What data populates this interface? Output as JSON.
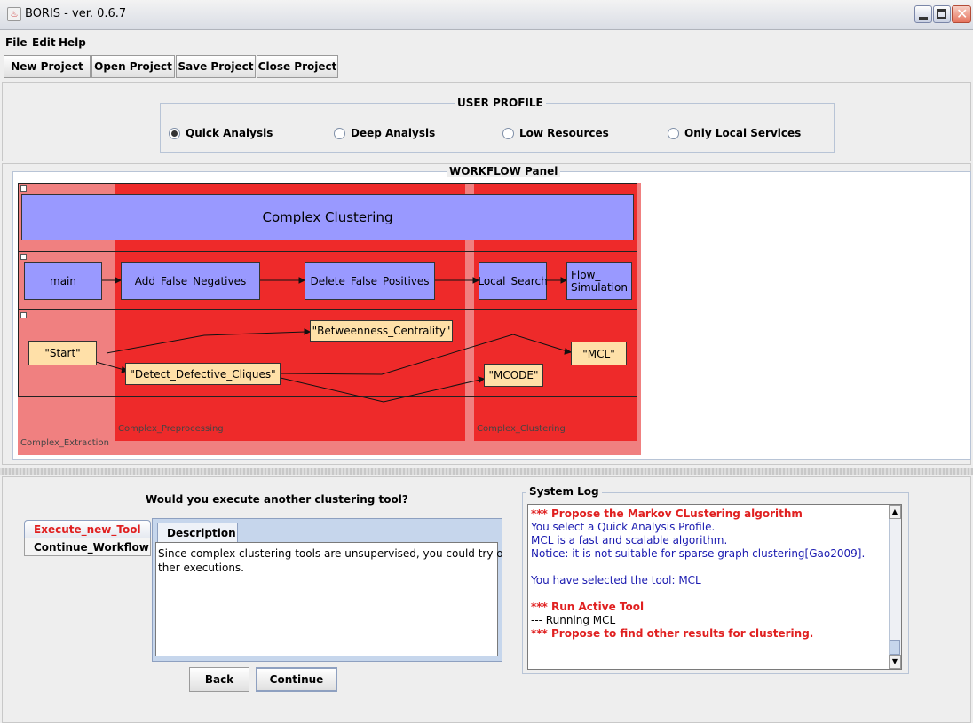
{
  "window": {
    "title": "BORIS - ver. 0.6.7"
  },
  "menu": [
    "File",
    "Edit",
    "Help"
  ],
  "toolbar": {
    "new": "New Project",
    "open": "Open Project",
    "save": "Save Project",
    "close": "Close Project"
  },
  "profile": {
    "title": "USER PROFILE",
    "options": [
      "Quick Analysis",
      "Deep Analysis",
      "Low Resources",
      "Only Local Services"
    ],
    "selected": "Quick Analysis"
  },
  "workflow": {
    "title": "WORKFLOW Panel",
    "top_node": "Complex Clustering",
    "nodes": [
      "main",
      "Add_False_Negatives",
      "Delete_False_Positives",
      "Local_Search",
      "Flow_\nSimulation"
    ],
    "tasks": [
      "\"Start\"",
      "\"Betweenness_Centrality\"",
      "\"Detect_Defective_Cliques\"",
      "\"MCL\"",
      "\"MCODE\""
    ],
    "lanes": [
      "Complex_Extraction",
      "Complex_Preprocessing",
      "Complex_Clustering"
    ]
  },
  "dialog": {
    "question": "Would you execute another clustering tool?",
    "tabs": [
      "Execute_new_Tool",
      "Continue_Workflow"
    ],
    "active_tab": "Execute_new_Tool",
    "desc_tab": "Description",
    "desc_text": "Since complex clustering tools are unsupervised, you could try o\nther executions.",
    "back": "Back",
    "continue": "Continue"
  },
  "log": {
    "title": "System Log",
    "lines": [
      {
        "text": "*** Propose the Markov CLustering algorithm",
        "style": "red-bold"
      },
      {
        "text": "You select a Quick Analysis Profile.",
        "style": "blue"
      },
      {
        "text": "MCL is a fast and scalable algorithm.",
        "style": "blue"
      },
      {
        "text": "Notice: it is not suitable for sparse graph clustering[Gao2009].",
        "style": "blue"
      },
      {
        "text": "",
        "style": "blue"
      },
      {
        "text": "You have selected the tool: MCL",
        "style": "blue"
      },
      {
        "text": "",
        "style": "blue"
      },
      {
        "text": "*** Run Active Tool",
        "style": "red-bold"
      },
      {
        "text": "--- Running MCL",
        "style": "black"
      },
      {
        "text": "*** Propose to find other results for clustering.",
        "style": "red-bold"
      }
    ]
  },
  "colors": {
    "lane_light": "#f08080",
    "lane_red": "#ee2222",
    "node_blue": "#9999ff",
    "task_yellow": "#ffe0a8",
    "log_red": "#e02020",
    "log_blue": "#1a1ab0"
  }
}
